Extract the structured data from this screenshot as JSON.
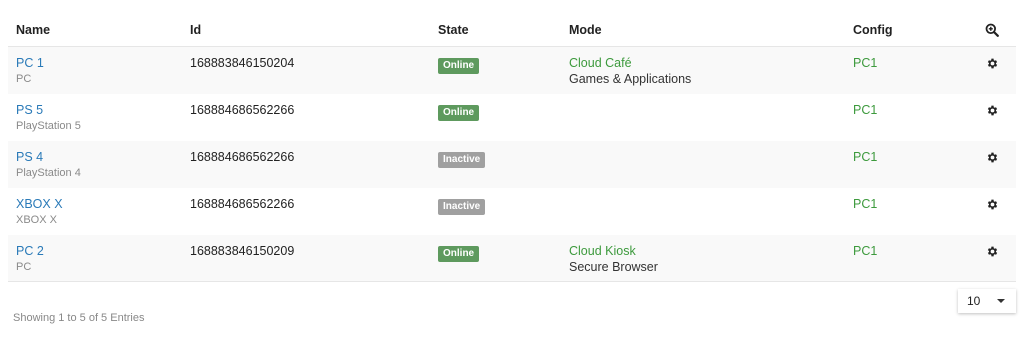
{
  "table": {
    "headers": {
      "name": "Name",
      "id": "Id",
      "state": "State",
      "mode": "Mode",
      "config": "Config"
    },
    "search_icon": "zoom-search-icon",
    "action_icon": "gear-icon",
    "rows": [
      {
        "name": "PC 1",
        "type": "PC",
        "id": "168883846150204",
        "state": "Online",
        "mode_name": "Cloud Café",
        "mode_desc": "Games & Applications",
        "config": "PC1"
      },
      {
        "name": "PS 5",
        "type": "PlayStation 5",
        "id": "168884686562266",
        "state": "Online",
        "mode_name": "",
        "mode_desc": "",
        "config": "PC1"
      },
      {
        "name": "PS 4",
        "type": "PlayStation 4",
        "id": "168884686562266",
        "state": "Inactive",
        "mode_name": "",
        "mode_desc": "",
        "config": "PC1"
      },
      {
        "name": "XBOX X",
        "type": "XBOX X",
        "id": "168884686562266",
        "state": "Inactive",
        "mode_name": "",
        "mode_desc": "",
        "config": "PC1"
      },
      {
        "name": "PC 2",
        "type": "PC",
        "id": "168883846150209",
        "state": "Online",
        "mode_name": "Cloud Kiosk",
        "mode_desc": "Secure Browser",
        "config": "PC1"
      }
    ]
  },
  "footer": {
    "showing": "Showing 1 to 5 of 5 Entries",
    "page_size": "10"
  },
  "colors": {
    "link": "#2a7ab8",
    "green": "#3d9a3d",
    "online": "#5e9a5e",
    "inactive": "#a0a0a0"
  }
}
